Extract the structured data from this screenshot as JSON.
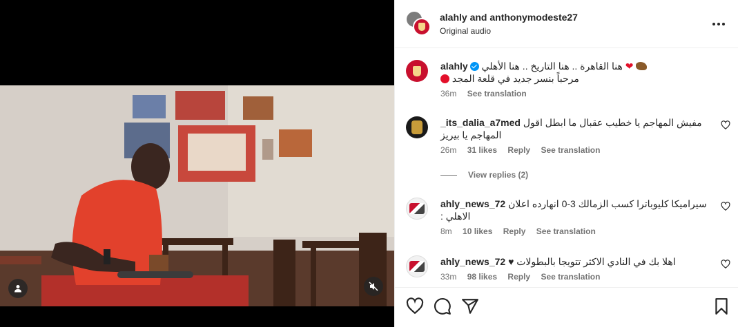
{
  "header": {
    "user1": "alahly",
    "joiner": "and",
    "user2": "anthonymodeste27",
    "audio": "Original audio"
  },
  "caption": {
    "username": "alahly",
    "line1": "هنا القاهرة .. هنا التاريخ .. هنا الأهلي",
    "line2": "مرحباً بنسر جديد في قلعة المجد",
    "time": "36m",
    "see_translation": "See translation"
  },
  "comments": [
    {
      "username": "_its_dalia_a7med",
      "text": "مفيش المهاجم يا خطيب عقبال ما ابطل اقول المهاجم يا بيريز",
      "time": "26m",
      "likes": "31 likes",
      "reply": "Reply",
      "see_translation": "See translation",
      "view_replies": "View replies (2)"
    },
    {
      "username": "ahly_news_72",
      "text": "سيراميكا كليوباترا كسب الزمالك 3-0 انهارده اعلان الاهلي :",
      "time": "8m",
      "likes": "10 likes",
      "reply": "Reply",
      "see_translation": "See translation"
    },
    {
      "username": "ahly_news_72",
      "text": "اهلا بك في النادي الاكثر تتويجا بالبطولات ♥",
      "time": "33m",
      "likes": "98 likes",
      "reply": "Reply",
      "see_translation": "See translation"
    }
  ],
  "icons": {
    "like": "heart-icon",
    "comment": "comment-bubble-icon",
    "share": "paper-plane-icon",
    "save": "bookmark-icon",
    "more": "ellipsis-icon",
    "mute": "speaker-muted-icon",
    "tag": "user-tag-icon"
  },
  "colors": {
    "accent": "#0095f6",
    "brand_red": "#c8102e",
    "secondary_text": "#737373"
  }
}
